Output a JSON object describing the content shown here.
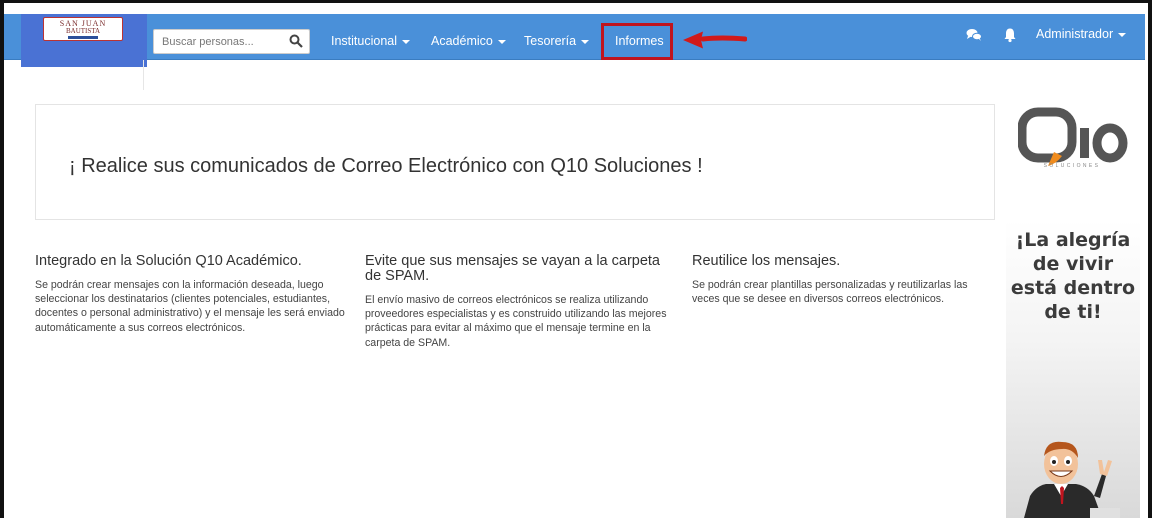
{
  "app": {
    "logo": {
      "line1": "SAN JUAN",
      "line2": "BAUTISTA"
    }
  },
  "navbar": {
    "search": {
      "placeholder": "Buscar personas..."
    },
    "menu": [
      {
        "label": "Institucional",
        "dropdown": true
      },
      {
        "label": "Académico",
        "dropdown": true
      },
      {
        "label": "Tesorería",
        "dropdown": true
      },
      {
        "label": "Informes",
        "dropdown": false,
        "highlighted": true
      }
    ],
    "user": {
      "label": "Administrador"
    },
    "icons": [
      "chat-icon",
      "bell-icon"
    ]
  },
  "colors": {
    "navbar": "#4a90d9",
    "logo_bg": "#4a72d4",
    "highlight": "#c0141e",
    "brand_orange": "#f08c1e"
  },
  "main": {
    "hero_title": "¡ Realice sus comunicados de Correo Electrónico con Q10 Soluciones !",
    "features": [
      {
        "title": "Integrado en la Solución Q10 Académico.",
        "text": "Se podrán crear mensajes con la información deseada, luego seleccionar los destinatarios (clientes potenciales, estudiantes, docentes o personal administrativo) y el mensaje les será enviado automáticamente a sus correos electrónicos."
      },
      {
        "title": "Evite que sus mensajes se vayan a la carpeta de SPAM.",
        "text": "El envío masivo de correos electrónicos se realiza utilizando proveedores especialistas y es construido utilizando las mejores prácticas para evitar al máximo que el mensaje termine en la carpeta de SPAM."
      },
      {
        "title": "Reutilice los mensajes.",
        "text": "Se podrán crear plantillas personalizadas y reutilizarlas las veces que se desee en diversos correos electrónicos."
      }
    ]
  },
  "sidebar": {
    "brand_sub": "SOLUCIONES",
    "promo_lines": [
      "¡La alegría",
      "de vivir",
      "está dentro",
      "de ti!"
    ]
  }
}
